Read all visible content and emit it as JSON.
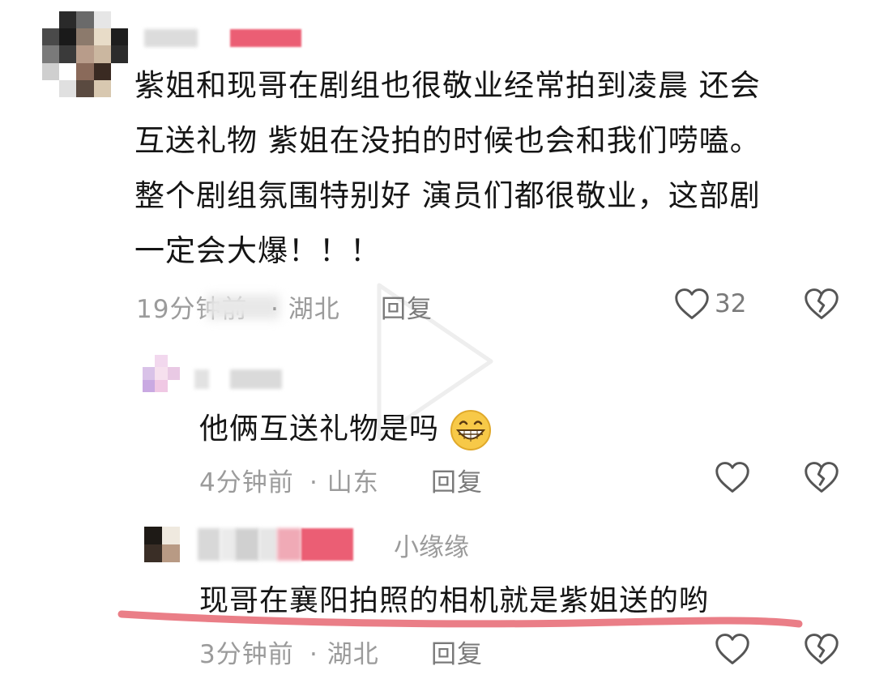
{
  "comment": {
    "text_lines": [
      "紫姐和现哥在剧组也很敬业经常拍到凌晨 还会",
      "互送礼物 紫姐在没拍的时候也会和我们唠嗑。",
      "整个剧组氛围特别好 演员们都很敬业，这部剧",
      "一定会大爆！！！"
    ],
    "time": "19分钟前",
    "location": "· 湖北",
    "reply_label": "回复",
    "like_count": "32"
  },
  "replies": [
    {
      "text": "他俩互送礼物是吗",
      "time": "4分钟前",
      "location": "· 山东",
      "reply_label": "回复"
    },
    {
      "tag_name": "小缘缘",
      "text": "现哥在襄阳拍照的相机就是紫姐送的哟",
      "time": "3分钟前",
      "location": "· 湖北",
      "reply_label": "回复"
    }
  ],
  "colors": {
    "underline": "#e8707a",
    "accent_pink": "#e8425c"
  }
}
